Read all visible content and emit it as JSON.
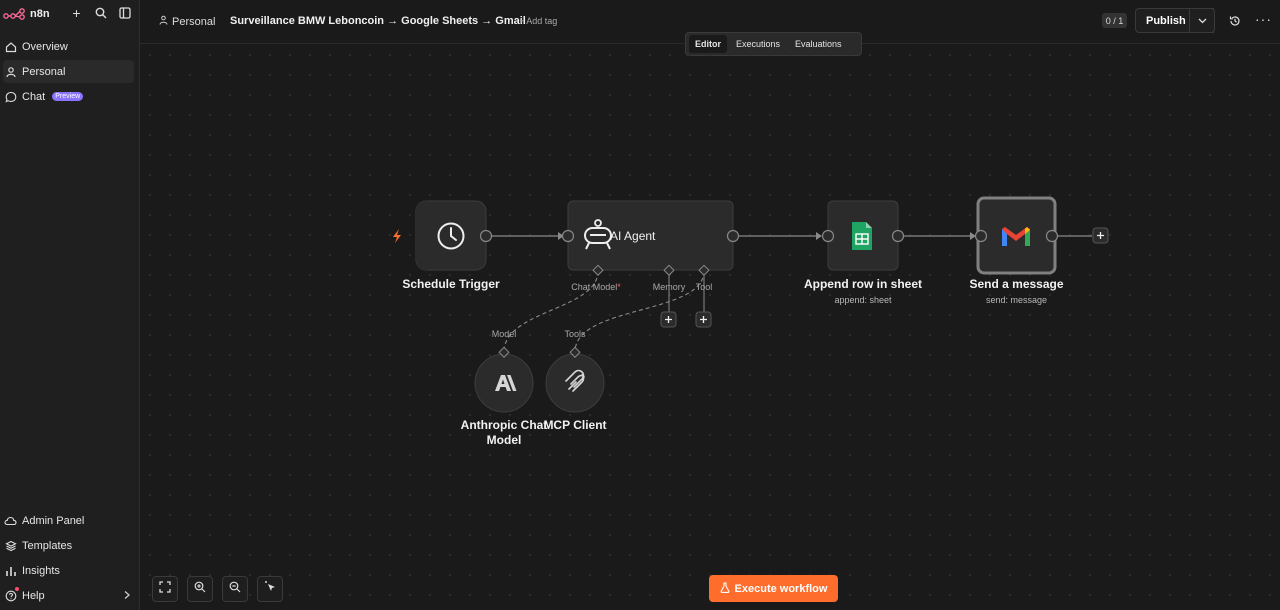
{
  "app": {
    "logo_text": "n8n"
  },
  "sidebar": {
    "items": [
      {
        "label": "Overview"
      },
      {
        "label": "Personal"
      },
      {
        "label": "Chat",
        "badge": "Preview"
      }
    ],
    "bottom_items": [
      {
        "label": "Admin Panel"
      },
      {
        "label": "Templates"
      },
      {
        "label": "Insights"
      },
      {
        "label": "Help"
      }
    ]
  },
  "header": {
    "project": "Personal",
    "workflow_title": "Surveillance BMW Leboncoin → Google Sheets → Gmail",
    "add_tag": "+ Add tag",
    "counter": "0 / 1",
    "publish": "Publish"
  },
  "tabs": [
    "Editor",
    "Executions",
    "Evaluations"
  ],
  "nodes": {
    "schedule": {
      "label": "Schedule Trigger"
    },
    "agent": {
      "label": "AI Agent",
      "ports": {
        "chat_model": "Chat Model",
        "required": "*",
        "memory": "Memory",
        "tool": "Tool"
      }
    },
    "sheets": {
      "label": "Append row in sheet",
      "sub": "append: sheet"
    },
    "gmail": {
      "label": "Send a message",
      "sub": "send: message"
    },
    "anthropic": {
      "label_line1": "Anthropic Chat",
      "label_line2": "Model",
      "port": "Model"
    },
    "mcp": {
      "label": "MCP Client",
      "port": "Tools"
    }
  },
  "execute_label": "Execute workflow",
  "colors": {
    "accent": "#ff6d2d",
    "badge": "#8b72ff",
    "background": "#1a1a1a"
  }
}
